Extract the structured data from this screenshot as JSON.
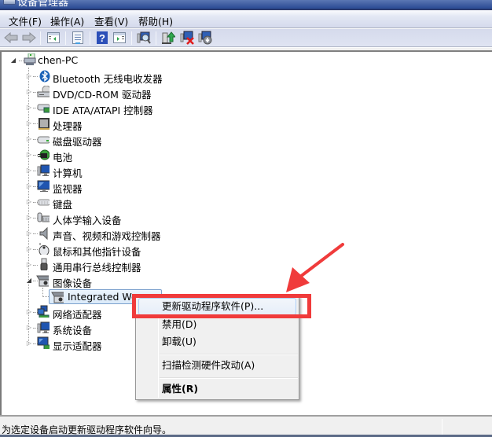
{
  "window": {
    "title": "设备管理器"
  },
  "menubar": {
    "items": [
      {
        "label": "文件(F)"
      },
      {
        "label": "操作(A)"
      },
      {
        "label": "查看(V)"
      },
      {
        "label": "帮助(H)"
      }
    ]
  },
  "toolbar": {
    "buttons": [
      {
        "icon": "back-arrow-icon"
      },
      {
        "icon": "forward-arrow-icon"
      },
      {
        "icon": "show-hide-console-tree-icon"
      },
      {
        "icon": "properties-icon"
      },
      {
        "icon": "help-icon"
      },
      {
        "icon": "show-hide-action-pane-icon"
      },
      {
        "icon": "scan-hardware-changes-icon"
      },
      {
        "icon": "update-driver-icon"
      },
      {
        "icon": "uninstall-icon"
      },
      {
        "icon": "disable-icon"
      }
    ]
  },
  "tree": {
    "root": {
      "label": "chen-PC",
      "icon": "computer-icon",
      "expanded": true
    },
    "categories": [
      {
        "label": "Bluetooth 无线电收发器",
        "icon": "bluetooth-icon",
        "expanded": false
      },
      {
        "label": "DVD/CD-ROM 驱动器",
        "icon": "dvd-drive-icon",
        "expanded": false
      },
      {
        "label": "IDE ATA/ATAPI 控制器",
        "icon": "ide-controller-icon",
        "expanded": false
      },
      {
        "label": "处理器",
        "icon": "processor-icon",
        "expanded": false
      },
      {
        "label": "磁盘驱动器",
        "icon": "disk-drive-icon",
        "expanded": false
      },
      {
        "label": "电池",
        "icon": "battery-icon",
        "expanded": false
      },
      {
        "label": "计算机",
        "icon": "computer-icon",
        "expanded": false
      },
      {
        "label": "监视器",
        "icon": "monitor-icon",
        "expanded": false
      },
      {
        "label": "键盘",
        "icon": "keyboard-icon",
        "expanded": false
      },
      {
        "label": "人体学输入设备",
        "icon": "hid-icon",
        "expanded": false
      },
      {
        "label": "声音、视频和游戏控制器",
        "icon": "speaker-icon",
        "expanded": false
      },
      {
        "label": "鼠标和其他指针设备",
        "icon": "mouse-icon",
        "expanded": false
      },
      {
        "label": "通用串行总线控制器",
        "icon": "usb-icon",
        "expanded": false
      },
      {
        "label": "图像设备",
        "icon": "imaging-device-icon",
        "expanded": true,
        "children": [
          {
            "label": "Integrated We",
            "icon": "webcam-icon",
            "selected": true
          }
        ]
      },
      {
        "label": "网络适配器",
        "icon": "network-adapter-icon",
        "expanded": false
      },
      {
        "label": "系统设备",
        "icon": "system-device-icon",
        "expanded": false
      },
      {
        "label": "显示适配器",
        "icon": "display-adapter-icon",
        "expanded": false
      }
    ]
  },
  "context_menu": {
    "items": [
      {
        "label": "更新驱动程序软件(P)...",
        "highlighted": true
      },
      {
        "label": "禁用(D)"
      },
      {
        "label": "卸载(U)"
      },
      {
        "label": "扫描检测硬件改动(A)"
      },
      {
        "label": "属性(R)",
        "bold": true
      }
    ]
  },
  "annotation": {
    "color": "#f03b3b"
  },
  "statusbar": {
    "text": "为选定设备启动更新驱动程序软件向导。"
  }
}
